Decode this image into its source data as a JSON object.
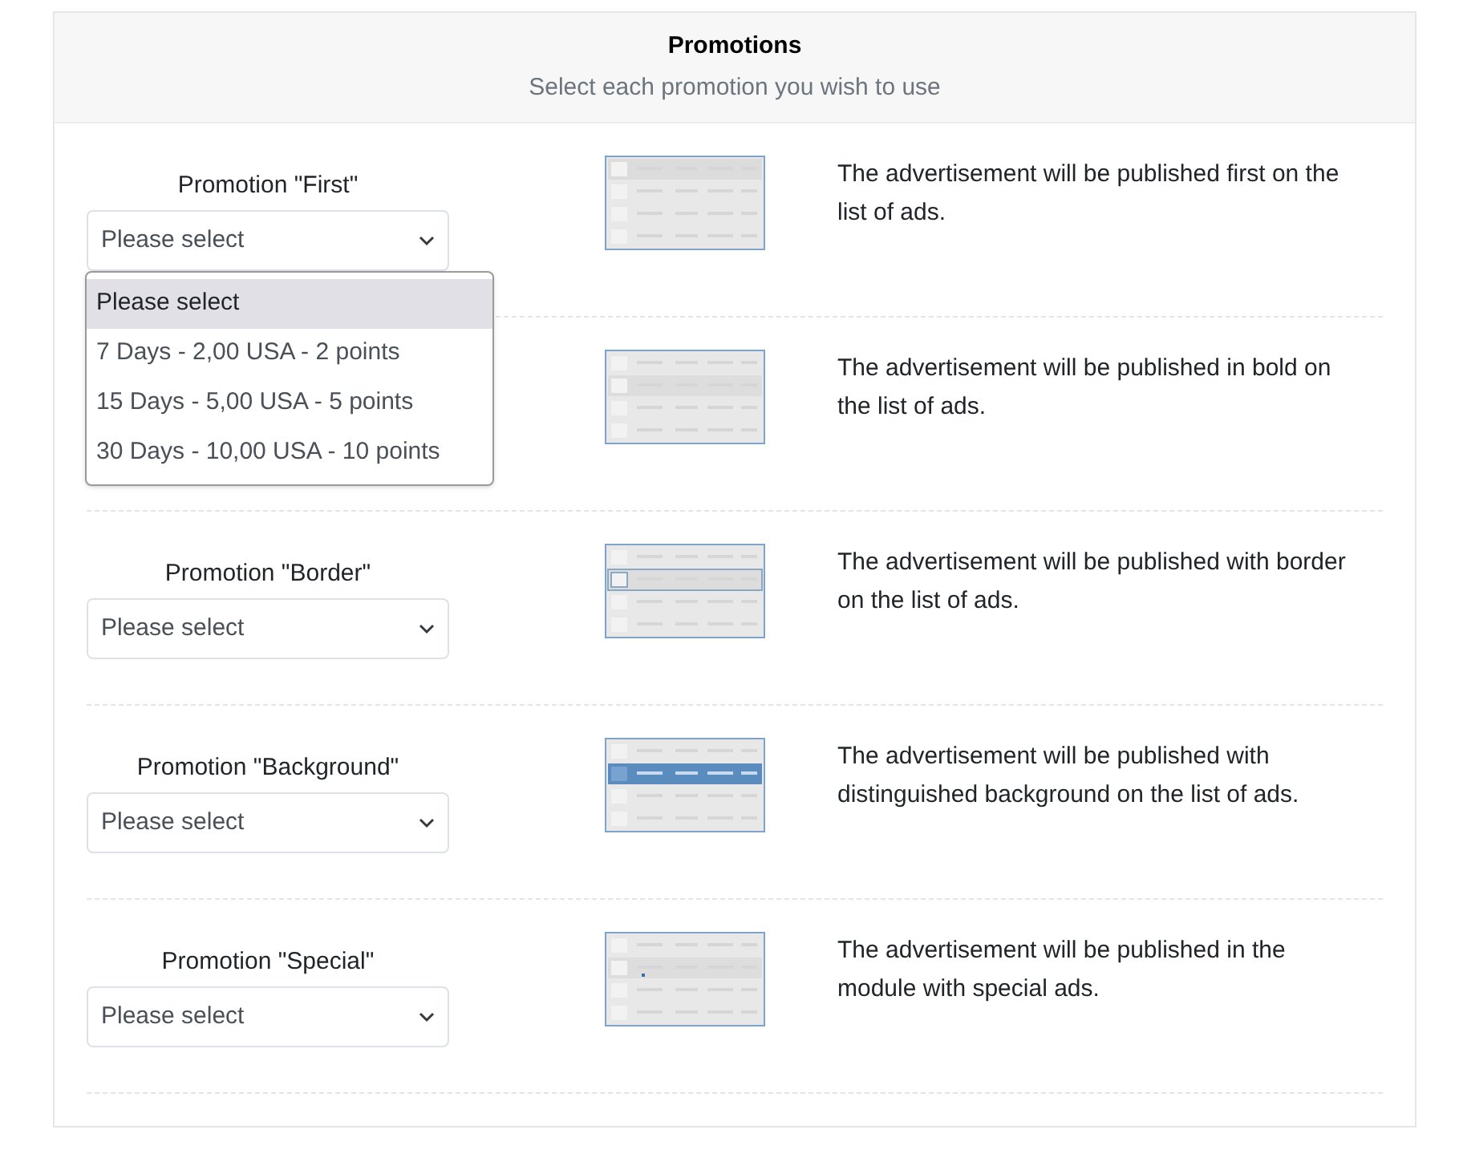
{
  "header": {
    "title": "Promotions",
    "subtitle": "Select each promotion you wish to use"
  },
  "promotions": [
    {
      "label": "Promotion \"First\"",
      "select": {
        "value": "Please select",
        "expanded": true,
        "options": [
          {
            "label": "Please select",
            "selected": true
          },
          {
            "label": "7 Days - 2,00 USA - 2 points",
            "selected": false
          },
          {
            "label": "15 Days - 5,00 USA - 5 points",
            "selected": false
          },
          {
            "label": "30 Days - 10,00 USA - 10 points",
            "selected": false
          }
        ]
      },
      "kind": "first",
      "description": "The advertisement will be published first on the list of ads."
    },
    {
      "kind": "bold",
      "description": "The advertisement will be published in bold on the list of ads."
    },
    {
      "label": "Promotion \"Border\"",
      "select": {
        "value": "Please select",
        "expanded": false
      },
      "kind": "border",
      "description": "The advertisement will be published with border on the list of ads."
    },
    {
      "label": "Promotion \"Background\"",
      "select": {
        "value": "Please select",
        "expanded": false
      },
      "kind": "background",
      "description": "The advertisement will be published with distinguished background on the list of ads."
    },
    {
      "label": "Promotion \"Special\"",
      "select": {
        "value": "Please select",
        "expanded": false
      },
      "kind": "special",
      "description": "The advertisement will be published in the module with special ads."
    }
  ]
}
